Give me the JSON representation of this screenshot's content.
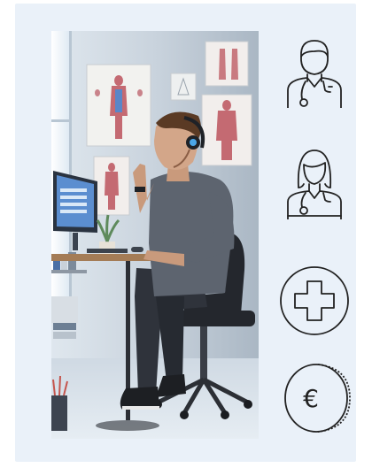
{
  "colors": {
    "card_background": "#eaf1f9",
    "icon_stroke": "#222222"
  },
  "hero": {
    "image_subject": "illustration-man-at-desk"
  },
  "icons": [
    {
      "name": "male-doctor-icon"
    },
    {
      "name": "female-doctor-icon"
    },
    {
      "name": "medical-cross-icon"
    },
    {
      "name": "euro-coin-icon",
      "glyph": "€"
    }
  ]
}
